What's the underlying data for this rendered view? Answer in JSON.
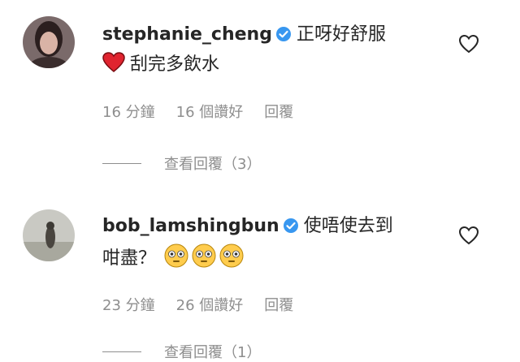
{
  "comments": [
    {
      "username": "stephanie_cheng",
      "text_line1": "正呀好舒服",
      "text_line2": "刮完多飲水",
      "time": "16 分鐘",
      "likes": "16 個讚好",
      "reply_label": "回覆",
      "view_replies": "查看回覆（3）"
    },
    {
      "username": "bob_lamshingbun",
      "text_line1": "使唔使去到",
      "text_line2": "咁盡？",
      "time": "23 分鐘",
      "likes": "26 個讚好",
      "reply_label": "回覆",
      "view_replies": "查看回覆（1）"
    }
  ],
  "colors": {
    "verified_blue": "#3897f0",
    "heart_red": "#ed4956",
    "meta_gray": "#8e8e8e"
  },
  "icons": [
    "verified-badge-icon",
    "red-heart-emoji-icon",
    "flushed-face-emoji-icon",
    "heart-outline-icon"
  ]
}
